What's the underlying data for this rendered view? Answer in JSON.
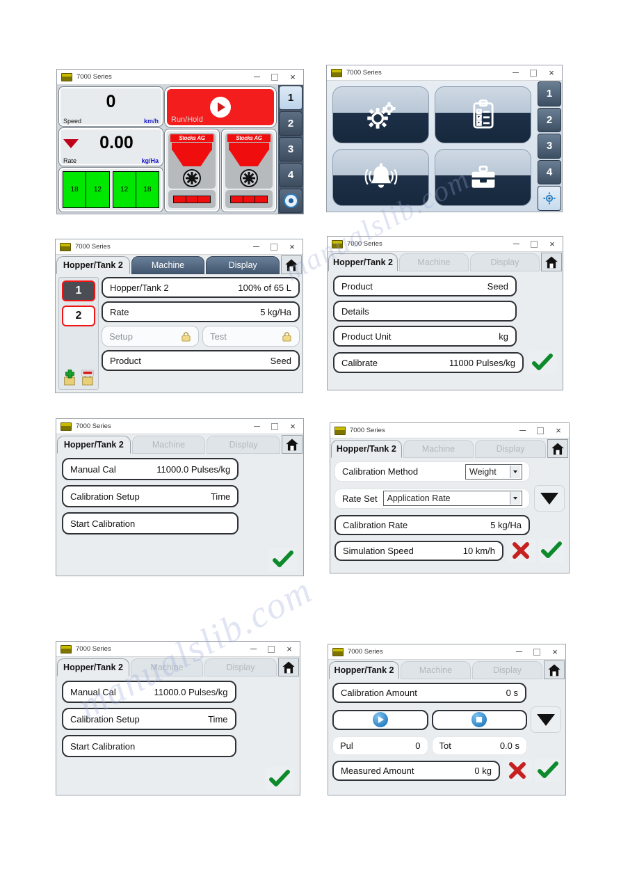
{
  "window": {
    "title": "7000 Series",
    "minimize_label": "minimize",
    "maximize_label": "maximize",
    "close_label": "×"
  },
  "panels": {
    "run_screen": {
      "speed": {
        "value": "0",
        "label": "Speed",
        "unit": "km/h"
      },
      "rate": {
        "value": "0.00",
        "label": "Rate",
        "unit": "kg/Ha"
      },
      "sections": [
        "18",
        "12",
        "12",
        "18"
      ],
      "run_hold": {
        "label": "Run/Hold",
        "color": "#f41d1d"
      },
      "hopper_brand": "Stocks AG",
      "side_buttons": [
        "1",
        "2",
        "3",
        "4"
      ],
      "side_icon": "eye-icon",
      "selected_side_button": "1"
    },
    "menu_screen": {
      "tiles": [
        "settings-gears-icon",
        "clipboard-checklist-icon",
        "alarm-bell-icon",
        "toolbox-icon"
      ],
      "side_buttons": [
        "1",
        "2",
        "3",
        "4"
      ],
      "side_icon": "gear-icon",
      "selected_side_button": "gear"
    },
    "hopper_tank_main": {
      "tabs": [
        {
          "label": "Hopper/Tank 2",
          "state": "active"
        },
        {
          "label": "Machine",
          "state": "blue"
        },
        {
          "label": "Display",
          "state": "blue"
        }
      ],
      "home_icon": "home-icon",
      "hopper_buttons": [
        {
          "label": "1",
          "state": "on"
        },
        {
          "label": "2",
          "state": "off"
        }
      ],
      "add_icon": "add-hopper-locked-icon",
      "remove_icon": "remove-hopper-locked-icon",
      "rows": [
        {
          "key": "Hopper/Tank 2",
          "value": "100% of 65 L"
        },
        {
          "key": "Rate",
          "value": "5 kg/Ha"
        },
        {
          "key": "Setup",
          "value": "",
          "locked": true
        },
        {
          "key": "Test",
          "value": "",
          "locked": true
        },
        {
          "key": "Product",
          "value": "Seed"
        }
      ]
    },
    "product_screen": {
      "tabs": [
        {
          "label": "Hopper/Tank 2",
          "state": "active"
        },
        {
          "label": "Machine",
          "state": "dim"
        },
        {
          "label": "Display",
          "state": "dim"
        }
      ],
      "home_icon": "home-icon",
      "rows": [
        {
          "key": "Product",
          "value": "Seed"
        },
        {
          "key": "Details",
          "value": ""
        },
        {
          "key": "Product Unit",
          "value": "kg"
        },
        {
          "key": "Calibrate",
          "value": "11000 Pulses/kg"
        }
      ],
      "confirm_icon": "green-check-icon"
    },
    "manual_cal_a": {
      "tabs": [
        {
          "label": "Hopper/Tank 2",
          "state": "active"
        },
        {
          "label": "Machine",
          "state": "dim"
        },
        {
          "label": "Display",
          "state": "dim"
        }
      ],
      "home_icon": "home-icon",
      "rows": [
        {
          "key": "Manual Cal",
          "value": "11000.0 Pulses/kg"
        },
        {
          "key": "Calibration Setup",
          "value": "Time"
        },
        {
          "key": "Start Calibration",
          "value": ""
        }
      ],
      "confirm_icon": "green-check-icon"
    },
    "calibration_method": {
      "tabs": [
        {
          "label": "Hopper/Tank 2",
          "state": "active"
        },
        {
          "label": "Machine",
          "state": "dim"
        },
        {
          "label": "Display",
          "state": "dim"
        }
      ],
      "home_icon": "home-icon",
      "method_label": "Calibration Method",
      "method_value": "Weight",
      "rate_set_label": "Rate Set",
      "rate_set_value": "Application Rate",
      "rows": [
        {
          "key": "Calibration Rate",
          "value": "5 kg/Ha"
        },
        {
          "key": "Simulation Speed",
          "value": "10 km/h"
        }
      ],
      "down_icon": "down-arrow-icon",
      "cancel_icon": "red-x-icon",
      "confirm_icon": "green-check-icon"
    },
    "manual_cal_b": {
      "tabs": [
        {
          "label": "Hopper/Tank 2",
          "state": "active"
        },
        {
          "label": "Machine",
          "state": "dim"
        },
        {
          "label": "Display",
          "state": "dim"
        }
      ],
      "home_icon": "home-icon",
      "rows": [
        {
          "key": "Manual Cal",
          "value": "11000.0 Pulses/kg"
        },
        {
          "key": "Calibration Setup",
          "value": "Time"
        },
        {
          "key": "Start Calibration",
          "value": ""
        }
      ],
      "confirm_icon": "green-check-icon"
    },
    "calibration_run": {
      "tabs": [
        {
          "label": "Hopper/Tank 2",
          "state": "active"
        },
        {
          "label": "Machine",
          "state": "dim"
        },
        {
          "label": "Display",
          "state": "dim"
        }
      ],
      "home_icon": "home-icon",
      "amount_row": {
        "key": "Calibration Amount",
        "value": "0 s"
      },
      "play_icon": "play-icon",
      "stop_icon": "stop-icon",
      "down_icon": "down-arrow-icon",
      "counters": [
        {
          "key": "Pul",
          "value": "0"
        },
        {
          "key": "Tot",
          "value": "0.0 s"
        }
      ],
      "measured_row": {
        "key": "Measured Amount",
        "value": "0 kg"
      },
      "cancel_icon": "red-x-icon",
      "confirm_icon": "green-check-icon"
    }
  },
  "watermark": {
    "line1": "manualslib.com",
    "line2": "manualslib.com"
  }
}
